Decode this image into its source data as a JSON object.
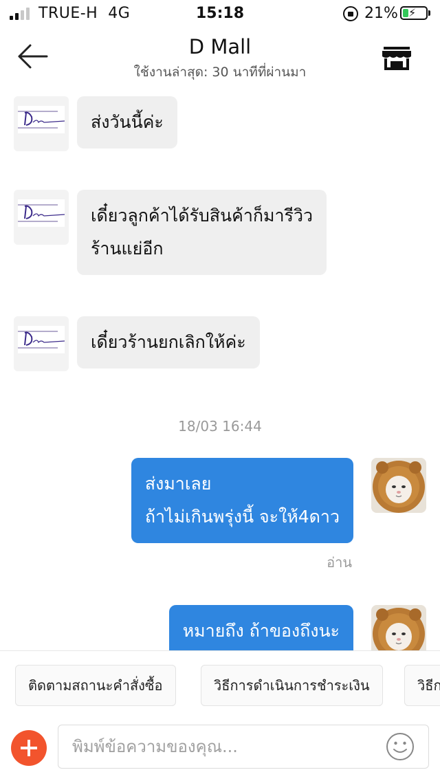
{
  "status_bar": {
    "carrier": "TRUE-H",
    "network": "4G",
    "time": "15:18",
    "battery": "21%",
    "signal_bars": 2
  },
  "header": {
    "title": "D Mall",
    "subtitle": "ใช้งานล่าสุด: 30 นาทีที่ผ่านมา",
    "back_icon": "arrow-left-icon",
    "store_icon": "store-icon"
  },
  "messages": [
    {
      "side": "shop",
      "lines": [
        "ส่งวันนี้ค่ะ"
      ]
    },
    {
      "side": "shop",
      "lines": [
        "เดี๋ยวลูกค้าได้รับสินค้าก็มารีวิว",
        "ร้านแย่อีก"
      ]
    },
    {
      "side": "shop",
      "lines": [
        "เดี๋ยวร้านยกเลิกให้ค่ะ"
      ]
    },
    {
      "side": "time",
      "text": "18/03 16:44"
    },
    {
      "side": "user",
      "lines": [
        "ส่งมาเลย",
        "ถ้าไม่เกินพรุ่งนี้ จะให้4ดาว"
      ],
      "status": "อ่าน"
    },
    {
      "side": "user",
      "lines": [
        "หมายถึง ถ้าของถึงนะ"
      ]
    }
  ],
  "quick_replies": [
    "ติดตามสถานะคำสั่งซื้อ",
    "วิธีการดำเนินการชำระเงิน",
    "วิธีก"
  ],
  "input": {
    "placeholder": "พิมพ์ข้อความของคุณ...",
    "plus_icon": "plus-icon",
    "emoji_icon": "smiley-icon"
  },
  "colors": {
    "outgoing_bubble": "#2f86e0",
    "incoming_bubble": "#efefef",
    "plus_button": "#f2542d",
    "battery_fill": "#34c759"
  }
}
